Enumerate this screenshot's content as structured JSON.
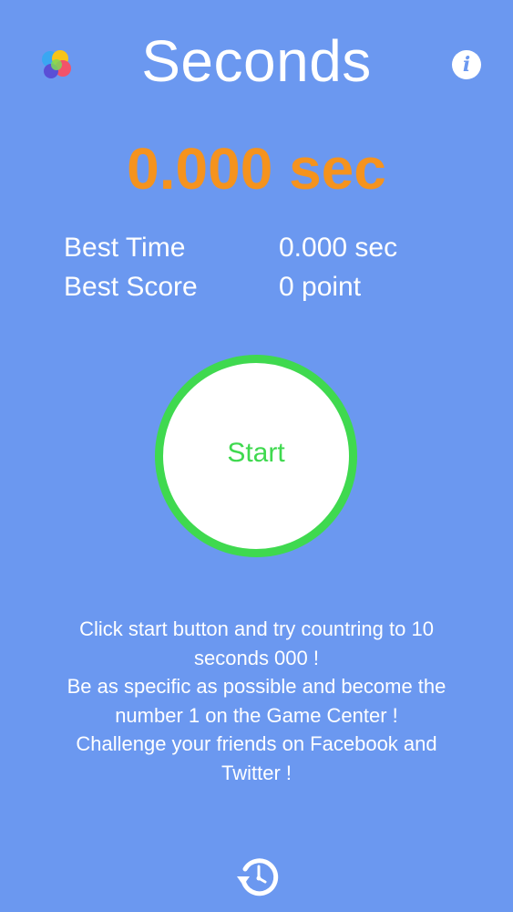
{
  "header": {
    "title": "Seconds",
    "game_center_icon": "game-center-icon",
    "info_icon": "info-icon",
    "info_glyph": "i"
  },
  "timer": {
    "display": "0.000 sec"
  },
  "stats": {
    "best_time_label": "Best Time",
    "best_time_value": "0.000 sec",
    "best_score_label": "Best Score",
    "best_score_value": "0 point"
  },
  "start_button": {
    "label": "Start"
  },
  "instructions": {
    "lines": [
      "Click start button and try countring to 10",
      "seconds 000 !",
      "Be as specific as possible and become the",
      "number 1 on the Game Center !",
      "Challenge your friends on Facebook and",
      "Twitter !"
    ]
  },
  "footer": {
    "history_icon": "history-clock-icon"
  },
  "colors": {
    "background": "#6b98f0",
    "timer": "#f5931e",
    "start_ring": "#3fd94f",
    "text": "#ffffff"
  }
}
